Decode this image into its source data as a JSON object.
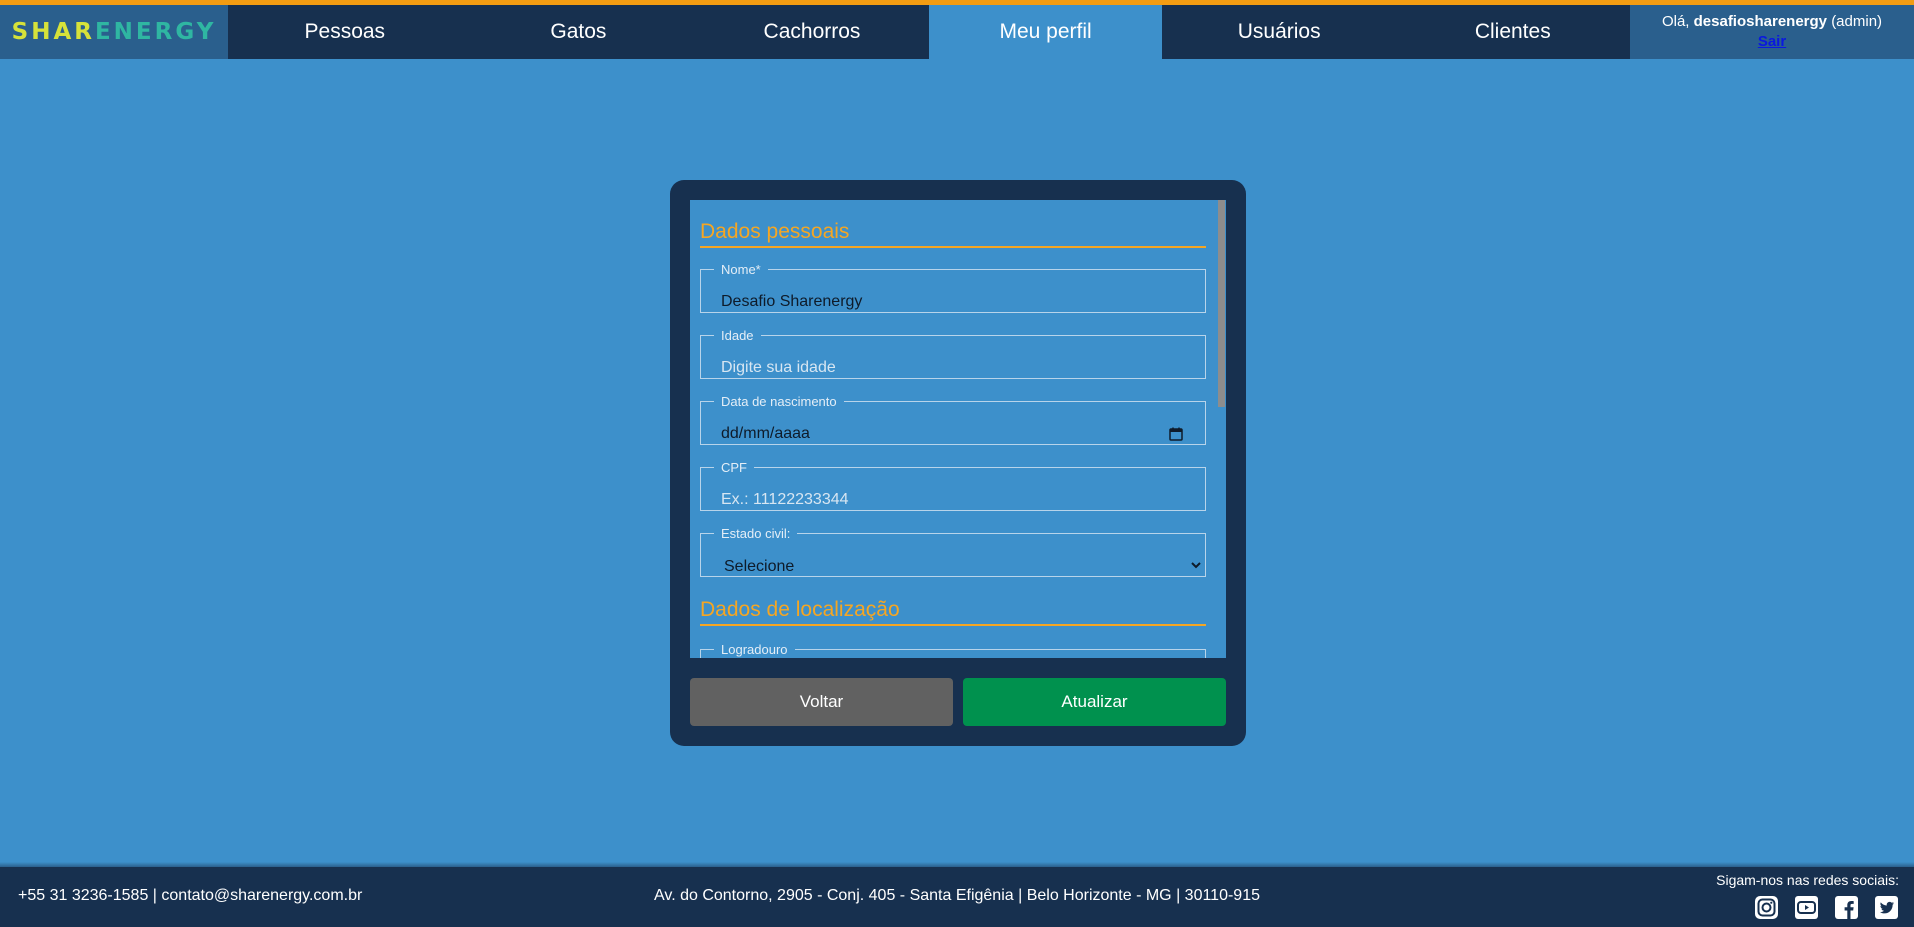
{
  "brand": {
    "logo_part1": "SHAR",
    "logo_part2": "ENERGY"
  },
  "nav": {
    "items": [
      {
        "label": "Pessoas"
      },
      {
        "label": "Gatos"
      },
      {
        "label": "Cachorros"
      },
      {
        "label": "Meu perfil"
      },
      {
        "label": "Usuários"
      },
      {
        "label": "Clientes"
      }
    ],
    "active": "Meu perfil"
  },
  "user": {
    "greeting": "Olá,",
    "username": "desafiosharenergy",
    "role": "(admin)",
    "logout": "Sair"
  },
  "form": {
    "section_personal": "Dados pessoais",
    "name": {
      "label": "Nome*",
      "value": "Desafio Sharenergy"
    },
    "age": {
      "label": "Idade",
      "placeholder": "Digite sua idade"
    },
    "birthdate": {
      "label": "Data de nascimento",
      "placeholder": "dd/mm/aaaa"
    },
    "cpf": {
      "label": "CPF",
      "placeholder": "Ex.: 11122233344"
    },
    "marital": {
      "label": "Estado civil:",
      "selected": "Selecione"
    },
    "section_location": "Dados de localização",
    "street": {
      "label": "Logradouro"
    }
  },
  "buttons": {
    "back": "Voltar",
    "update": "Atualizar"
  },
  "footer": {
    "contact": "+55 31 3236-1585 | contato@sharenergy.com.br",
    "address": "Av. do Contorno, 2905 - Conj. 405 - Santa Efigênia | Belo Horizonte - MG | 30110-915",
    "social_label": "Sigam-nos nas redes sociais:",
    "social_icons": [
      "instagram-icon",
      "youtube-icon",
      "facebook-icon",
      "twitter-icon"
    ]
  },
  "colors": {
    "background": "#3d90cb",
    "header": "#17304f",
    "accent": "#f39c12",
    "section_title": "#f5a623",
    "update_button": "#00914e",
    "back_button": "#616161"
  }
}
